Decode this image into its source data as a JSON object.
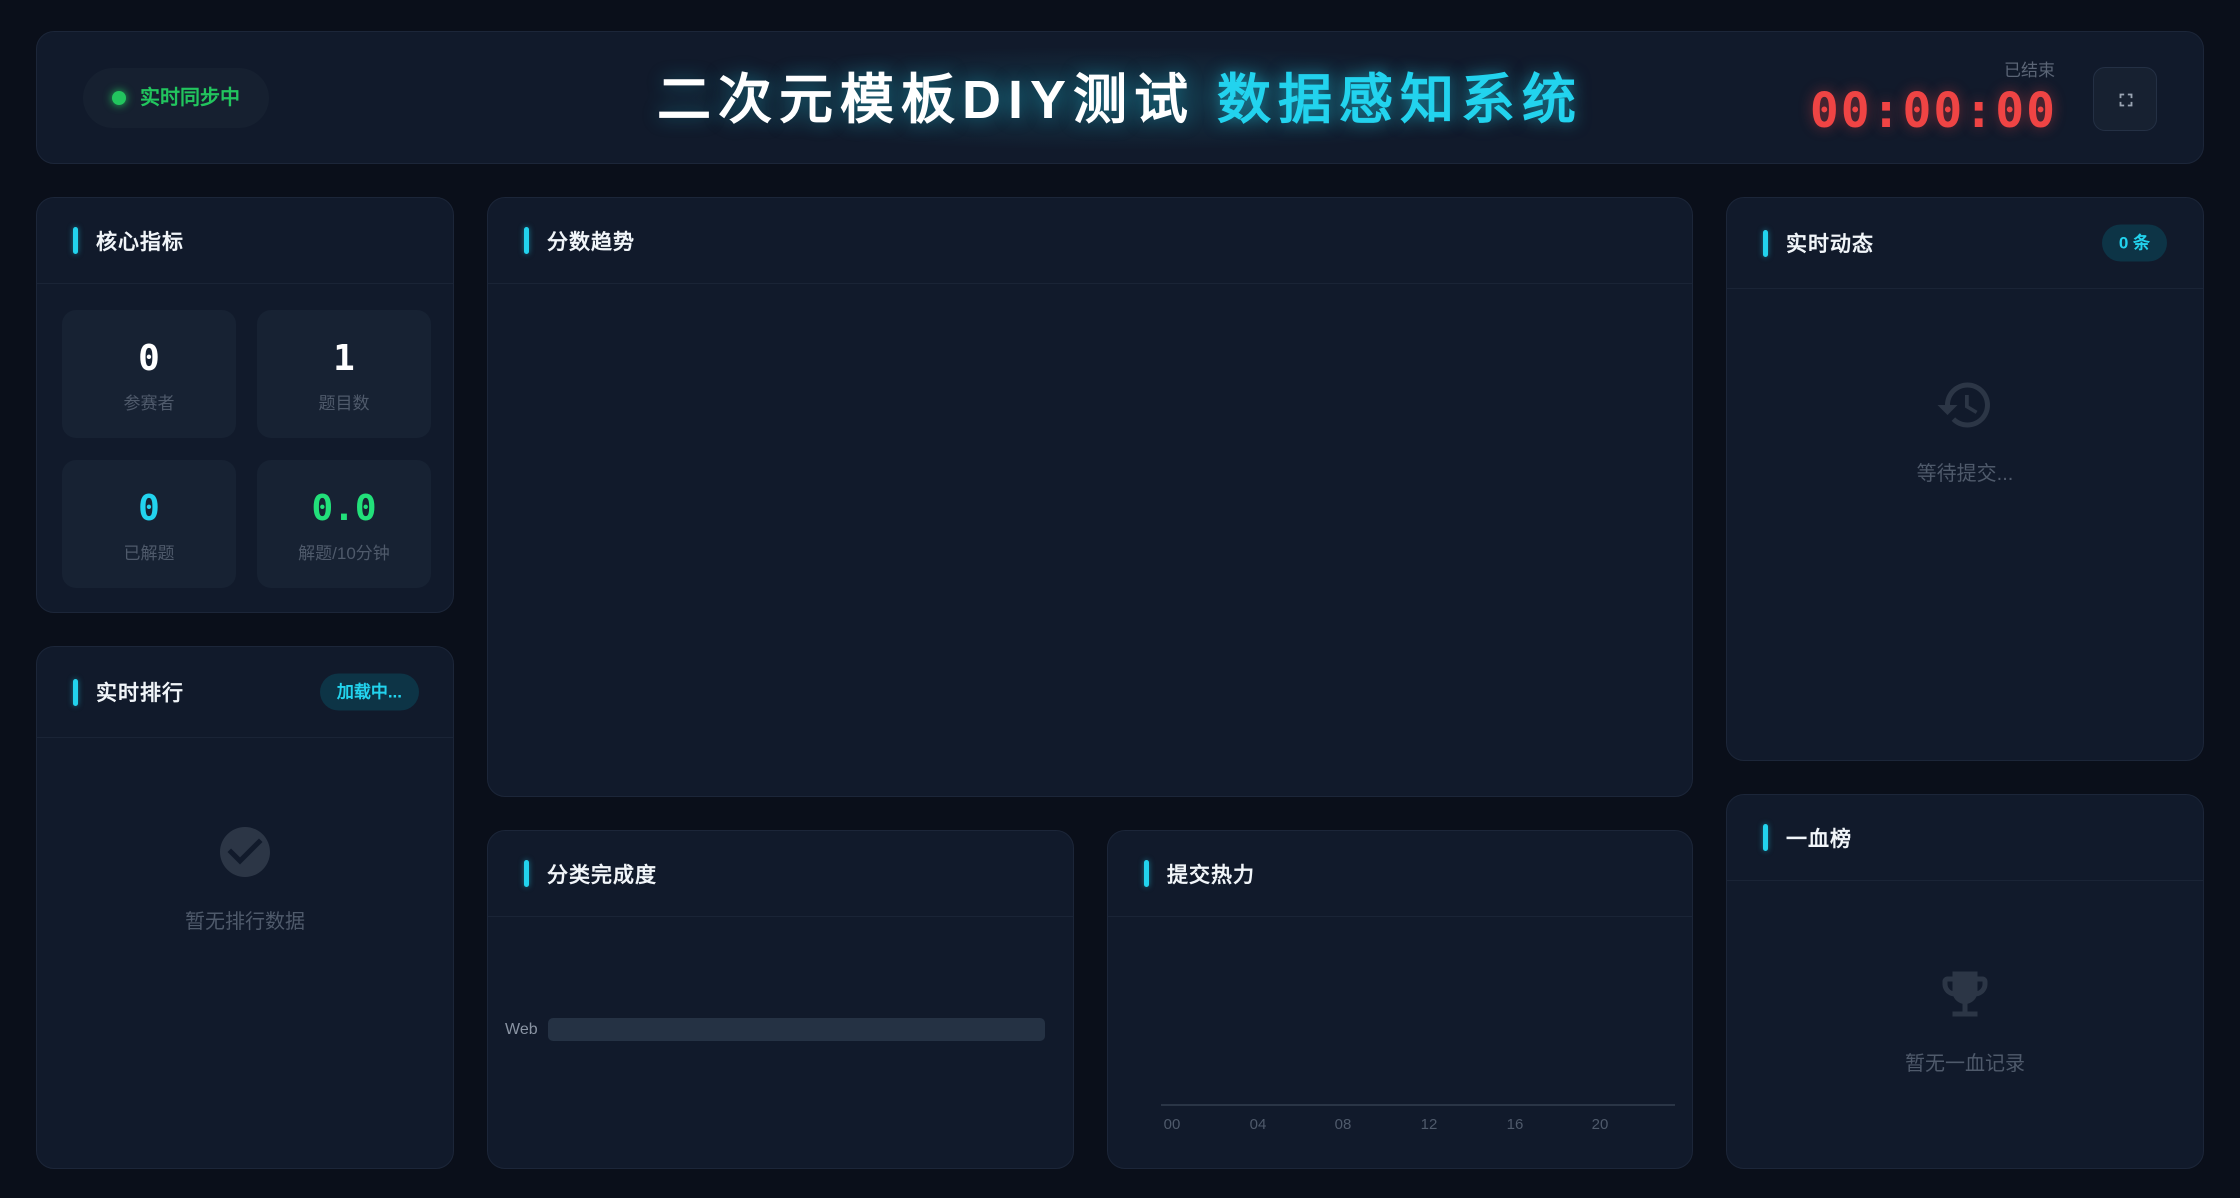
{
  "header": {
    "sync_status": "实时同步中",
    "title_main": "二次元模板DIY测试",
    "title_accent": "数据感知系统",
    "timer_status": "已结束",
    "timer": "00:00:00",
    "fullscreen_icon": "fullscreen-icon"
  },
  "metrics": {
    "title": "核心指标",
    "cards": [
      {
        "value": "0",
        "label": "参赛者",
        "color": "#ffffff"
      },
      {
        "value": "1",
        "label": "题目数",
        "color": "#ffffff"
      },
      {
        "value": "0",
        "label": "已解题",
        "color": "#22d3ee"
      },
      {
        "value": "0.0",
        "label": "解题/10分钟",
        "color": "#22e07a"
      }
    ]
  },
  "ranking": {
    "title": "实时排行",
    "badge": "加载中...",
    "empty_icon": "check-circle-icon",
    "empty_text": "暂无排行数据"
  },
  "score_trend": {
    "title": "分数趋势"
  },
  "category": {
    "title": "分类完成度",
    "rows": [
      {
        "label": "Web",
        "progress": 0
      }
    ]
  },
  "heat": {
    "title": "提交热力",
    "ticks": [
      "00",
      "04",
      "08",
      "12",
      "16",
      "20"
    ]
  },
  "activity": {
    "title": "实时动态",
    "badge": "0 条",
    "empty_icon": "history-icon",
    "empty_text": "等待提交..."
  },
  "first_blood": {
    "title": "一血榜",
    "empty_icon": "trophy-icon",
    "empty_text": "暂无一血记录"
  },
  "colors": {
    "background": "#0a0f1a",
    "panel": "#111a2b",
    "accent": "#22d3ee",
    "success": "#22c55e",
    "danger": "#ef4444",
    "muted": "#4f5a6b"
  }
}
